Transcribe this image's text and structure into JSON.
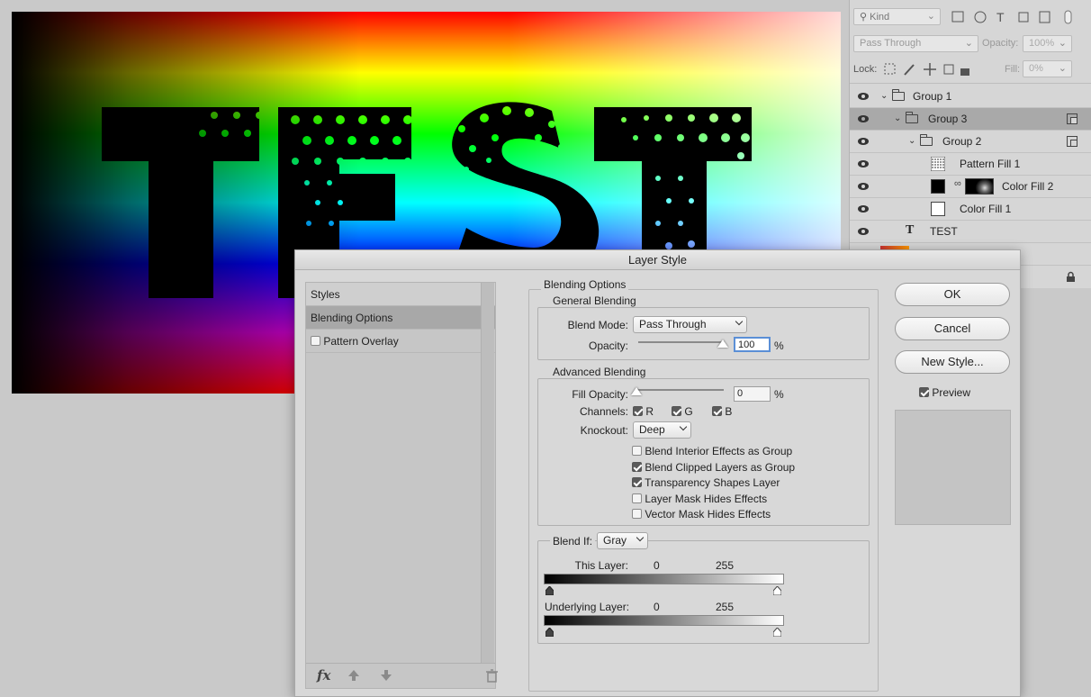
{
  "canvas": {
    "text": "TEST"
  },
  "layers_panel": {
    "filter_kind": "Kind",
    "blend_mode": "Pass Through",
    "opacity_label": "Opacity:",
    "opacity_value": "100%",
    "lock_label": "Lock:",
    "fill_label": "Fill:",
    "fill_value": "0%",
    "layers": [
      {
        "name": "Group 1"
      },
      {
        "name": "Group 3"
      },
      {
        "name": "Group 2"
      },
      {
        "name": "Pattern Fill 1"
      },
      {
        "name": "Color Fill 2"
      },
      {
        "name": "Color Fill 1"
      },
      {
        "name": "TEST"
      }
    ],
    "text_layer_glyph": "T"
  },
  "dialog": {
    "title": "Layer Style",
    "styles_label": "Styles",
    "blending_options_item": "Blending Options",
    "pattern_overlay_item": "Pattern Overlay",
    "section_title": "Blending Options",
    "general_blending": "General Blending",
    "blend_mode_label": "Blend Mode:",
    "blend_mode_value": "Pass Through",
    "opacity_label": "Opacity:",
    "opacity_value": "100",
    "percent": "%",
    "advanced_blending": "Advanced Blending",
    "fill_opacity_label": "Fill Opacity:",
    "fill_opacity_value": "0",
    "channels_label": "Channels:",
    "channel_r": "R",
    "channel_g": "G",
    "channel_b": "B",
    "knockout_label": "Knockout:",
    "knockout_value": "Deep",
    "options": [
      {
        "label": "Blend Interior Effects as Group",
        "checked": false
      },
      {
        "label": "Blend Clipped Layers as Group",
        "checked": true
      },
      {
        "label": "Transparency Shapes Layer",
        "checked": true
      },
      {
        "label": "Layer Mask Hides Effects",
        "checked": false
      },
      {
        "label": "Vector Mask Hides Effects",
        "checked": false
      }
    ],
    "blend_if_label": "Blend If:",
    "blend_if_value": "Gray",
    "this_layer_label": "This Layer:",
    "this_layer_low": "0",
    "this_layer_high": "255",
    "underlying_label": "Underlying Layer:",
    "underlying_low": "0",
    "underlying_high": "255",
    "ok": "OK",
    "cancel": "Cancel",
    "new_style": "New Style...",
    "preview_label": "Preview",
    "fx_label": "fx"
  }
}
